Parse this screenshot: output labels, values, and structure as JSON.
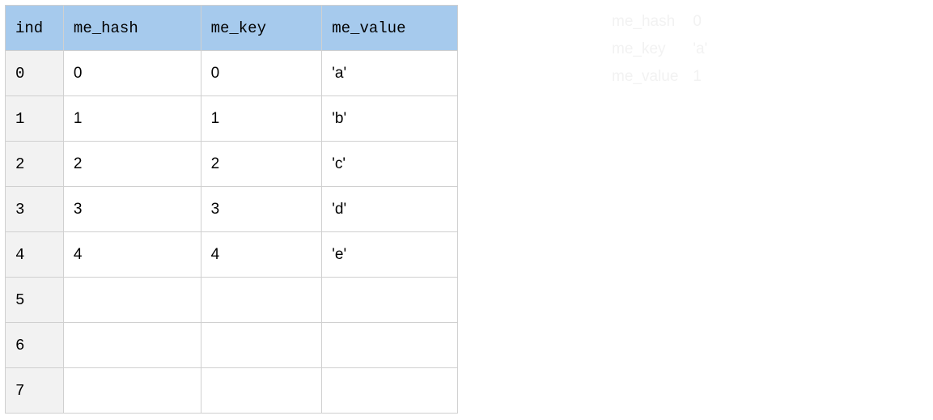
{
  "table": {
    "headers": {
      "ind": "ind",
      "hash": "me_hash",
      "key": "me_key",
      "value": "me_value"
    },
    "rows": [
      {
        "ind": "0",
        "hash": "0",
        "key": "0",
        "value": "'a'"
      },
      {
        "ind": "1",
        "hash": "1",
        "key": "1",
        "value": "'b'"
      },
      {
        "ind": "2",
        "hash": "2",
        "key": "2",
        "value": "'c'"
      },
      {
        "ind": "3",
        "hash": "3",
        "key": "3",
        "value": "'d'"
      },
      {
        "ind": "4",
        "hash": "4",
        "key": "4",
        "value": "'e'"
      },
      {
        "ind": "5",
        "hash": "",
        "key": "",
        "value": ""
      },
      {
        "ind": "6",
        "hash": "",
        "key": "",
        "value": ""
      },
      {
        "ind": "7",
        "hash": "",
        "key": "",
        "value": ""
      }
    ]
  },
  "side": {
    "rows": [
      {
        "label": "me_hash",
        "value": "0"
      },
      {
        "label": "me_key",
        "value": "'a'"
      },
      {
        "label": "me_value",
        "value": "1"
      }
    ]
  }
}
